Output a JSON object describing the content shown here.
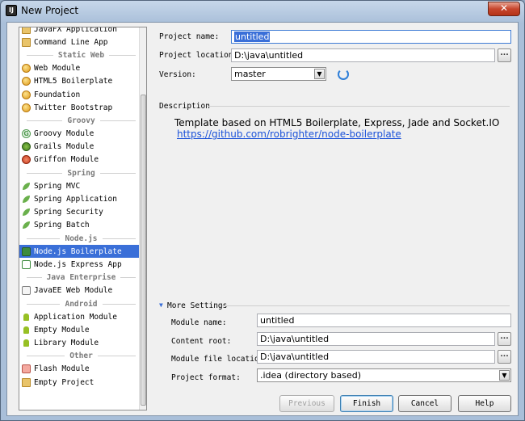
{
  "window": {
    "title": "New Project",
    "close_label": "✕"
  },
  "sidebar": {
    "items": [
      {
        "type": "item",
        "label": "JavaFX Application",
        "icon": "folder-icon"
      },
      {
        "type": "item",
        "label": "Command Line App",
        "icon": "folder-icon"
      },
      {
        "type": "header",
        "label": "Static Web"
      },
      {
        "type": "item",
        "label": "Web Module",
        "icon": "globe-icon"
      },
      {
        "type": "item",
        "label": "HTML5 Boilerplate",
        "icon": "globe-icon"
      },
      {
        "type": "item",
        "label": "Foundation",
        "icon": "globe-icon"
      },
      {
        "type": "item",
        "label": "Twitter Bootstrap",
        "icon": "globe-icon"
      },
      {
        "type": "header",
        "label": "Groovy"
      },
      {
        "type": "item",
        "label": "Groovy Module",
        "icon": "groovy-icon"
      },
      {
        "type": "item",
        "label": "Grails Module",
        "icon": "grails-icon"
      },
      {
        "type": "item",
        "label": "Griffon Module",
        "icon": "griffon-icon"
      },
      {
        "type": "header",
        "label": "Spring"
      },
      {
        "type": "item",
        "label": "Spring MVC",
        "icon": "spring-icon"
      },
      {
        "type": "item",
        "label": "Spring Application",
        "icon": "spring-icon"
      },
      {
        "type": "item",
        "label": "Spring Security",
        "icon": "spring-icon"
      },
      {
        "type": "item",
        "label": "Spring Batch",
        "icon": "spring-icon"
      },
      {
        "type": "header",
        "label": "Node.js"
      },
      {
        "type": "item",
        "label": "Node.js Boilerplate",
        "icon": "nodejs-icon",
        "selected": true
      },
      {
        "type": "item",
        "label": "Node.js Express App",
        "icon": "nodejs-express-icon"
      },
      {
        "type": "header",
        "label": "Java Enterprise"
      },
      {
        "type": "item",
        "label": "JavaEE Web Module",
        "icon": "javaee-icon"
      },
      {
        "type": "header",
        "label": "Android"
      },
      {
        "type": "item",
        "label": "Application Module",
        "icon": "android-icon"
      },
      {
        "type": "item",
        "label": "Empty Module",
        "icon": "android-icon"
      },
      {
        "type": "item",
        "label": "Library Module",
        "icon": "android-icon"
      },
      {
        "type": "header",
        "label": "Other"
      },
      {
        "type": "item",
        "label": "Flash Module",
        "icon": "flash-icon"
      },
      {
        "type": "item",
        "label": "Empty Project",
        "icon": "empty-project-icon"
      }
    ]
  },
  "form": {
    "project_name_label": "Project name:",
    "project_name_value": "untitled",
    "project_location_label": "Project location:",
    "project_location_value": "D:\\java\\untitled",
    "browse_label": "...",
    "version_label": "Version:",
    "version_value": "master",
    "description_label": "Description",
    "description_text": "Template based on HTML5 Boilerplate, Express, Jade and Socket.IO",
    "description_link": "https://github.com/robrighter/node-boilerplate"
  },
  "more_settings": {
    "label": "More Settings",
    "module_name_label": "Module name:",
    "module_name_value": "untitled",
    "content_root_label": "Content root:",
    "content_root_value": "D:\\java\\untitled",
    "module_file_label": "Module file location:",
    "module_file_value": "D:\\java\\untitled",
    "project_format_label": "Project format:",
    "project_format_value": ".idea (directory based)"
  },
  "buttons": {
    "previous": "Previous",
    "finish": "Finish",
    "cancel": "Cancel",
    "help": "Help"
  },
  "colors": {
    "selection": "#3a6fd8",
    "link": "#1b52d9"
  }
}
